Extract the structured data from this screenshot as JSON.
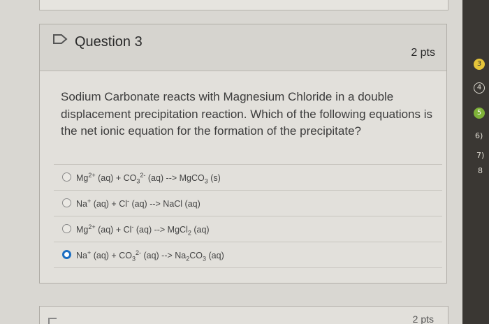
{
  "question": {
    "title": "Question 3",
    "points": "2 pts",
    "text": "Sodium Carbonate reacts with Magnesium Chloride in a double displacement precipitation reaction. Which of the following equations is the net ionic equation for the formation of the precipitate?"
  },
  "answers": [
    {
      "label": "Mg2+ (aq) + CO32- (aq) --> MgCO3 (s)",
      "selected": false
    },
    {
      "label": "Na+ (aq) + Cl- (aq) --> NaCl (aq)",
      "selected": false
    },
    {
      "label": "Mg2+ (aq) + Cl- (aq) --> MgCl2 (aq)",
      "selected": false
    },
    {
      "label": "Na+ (aq) + CO32- (aq) --> Na2CO3 (aq)",
      "selected": true
    }
  ],
  "next_question": {
    "points": "2 pts"
  },
  "side_marks": [
    "3",
    "4",
    "5",
    "6)",
    "7)",
    "8"
  ],
  "colors": {
    "selected_radio": "#1b6ec2",
    "card_background": "#e2e0db"
  },
  "icons": {
    "flag": "flag-outline-icon"
  }
}
